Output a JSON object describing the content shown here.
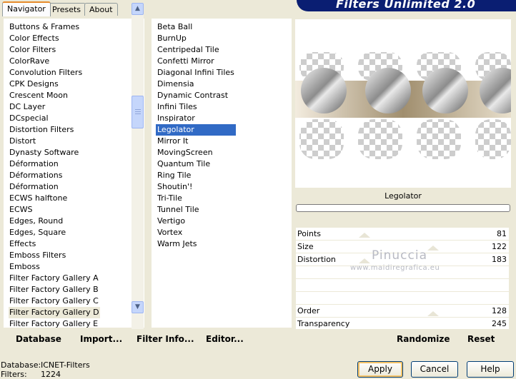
{
  "tabs": [
    "Navigator",
    "Presets",
    "About"
  ],
  "banner_title": "Filters Unlimited 2.0",
  "categories": [
    "Buttons & Frames",
    "Color Effects",
    "Color Filters",
    "ColorRave",
    "Convolution Filters",
    "CPK Designs",
    "Crescent Moon",
    "DC Layer",
    "DCspecial",
    "Distortion Filters",
    "Distort",
    "Dynasty Software",
    "Déformation",
    "Déformations",
    "Déformation",
    "ECWS halftone",
    "ECWS",
    "Edges, Round",
    "Edges, Square",
    "Effects",
    "Emboss Filters",
    "Emboss",
    "Filter Factory Gallery A",
    "Filter Factory Gallery B",
    "Filter Factory Gallery C",
    "Filter Factory Gallery D",
    "Filter Factory Gallery E"
  ],
  "selected_category": "Filter Factory Gallery D",
  "filters": [
    "Beta Ball",
    "BurnUp",
    "Centripedal Tile",
    "Confetti Mirror",
    "Diagonal Infini Tiles",
    "Dimensia",
    "Dynamic Contrast",
    "Infini Tiles",
    "Inspirator",
    "Legolator",
    "Mirror It",
    "MovingScreen",
    "Quantum Tile",
    "Ring Tile",
    "Shoutin'!",
    "Tri-Tile",
    "Tunnel Tile",
    "Vertigo",
    "Vortex",
    "Warm Jets"
  ],
  "selected_filter": "Legolator",
  "preview_label": "Legolator",
  "params": [
    {
      "label": "Points",
      "value": "81"
    },
    {
      "label": "Size",
      "value": "122"
    },
    {
      "label": "Distortion",
      "value": "183"
    },
    {
      "label": "",
      "value": ""
    },
    {
      "label": "",
      "value": ""
    },
    {
      "label": "Order",
      "value": "128"
    },
    {
      "label": "Transparency",
      "value": "245"
    }
  ],
  "watermark": {
    "name": "Pinuccia",
    "site": "www.maidiregrafica.eu"
  },
  "left_buttons": {
    "database": "Database",
    "import": "Import...",
    "filter_info": "Filter Info...",
    "editor": "Editor..."
  },
  "right_buttons": {
    "randomize": "Randomize",
    "reset": "Reset"
  },
  "dialog_buttons": {
    "apply": "Apply",
    "cancel": "Cancel",
    "help": "Help"
  },
  "info": {
    "database_label": "Database:",
    "database_value": "ICNET-Filters",
    "filters_label": "Filters:",
    "filters_value": "1224"
  },
  "colors": {
    "selection": "#316ac5",
    "panel": "#ece9d8",
    "banner": "#0a1e72"
  }
}
